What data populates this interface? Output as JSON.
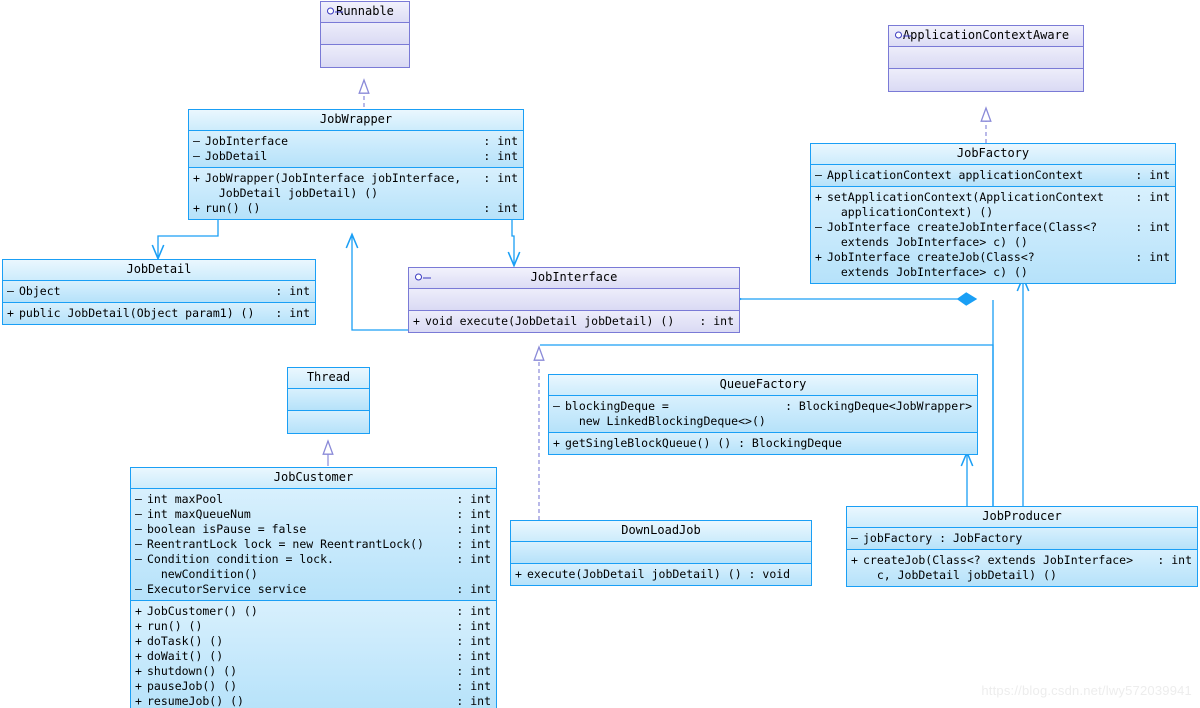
{
  "diagram": {
    "type": "uml-class-diagram",
    "watermark": "https://blog.csdn.net/lwy572039941"
  },
  "classes": {
    "runnable": {
      "name": "Runnable",
      "stereotype": "interface",
      "attributes": [],
      "operations": []
    },
    "applicationContextAware": {
      "name": "ApplicationContextAware",
      "stereotype": "interface",
      "attributes": [],
      "operations": []
    },
    "jobWrapper": {
      "name": "JobWrapper",
      "attributes": [
        {
          "vis": "–",
          "sig": "JobInterface",
          "type": ": int"
        },
        {
          "vis": "–",
          "sig": "JobDetail",
          "type": ": int"
        }
      ],
      "operations": [
        {
          "vis": "+",
          "sig": "JobWrapper(JobInterface jobInterface,\n  JobDetail jobDetail) ()",
          "type": ": int"
        },
        {
          "vis": "+",
          "sig": "run() ()",
          "type": ": int"
        }
      ]
    },
    "jobFactory": {
      "name": "JobFactory",
      "attributes": [
        {
          "vis": "–",
          "sig": "ApplicationContext applicationContext",
          "type": ": int"
        }
      ],
      "operations": [
        {
          "vis": "+",
          "sig": "setApplicationContext(ApplicationContext\n  applicationContext) ()",
          "type": ": int"
        },
        {
          "vis": "–",
          "sig": "JobInterface createJobInterface(Class<?\n  extends JobInterface> c) ()",
          "type": ": int"
        },
        {
          "vis": "+",
          "sig": "JobInterface createJob(Class<?\n  extends JobInterface> c) ()",
          "type": ": int"
        }
      ]
    },
    "jobDetail": {
      "name": "JobDetail",
      "attributes": [
        {
          "vis": "–",
          "sig": "Object",
          "type": ": int"
        }
      ],
      "operations": [
        {
          "vis": "+",
          "sig": "public JobDetail(Object param1) ()",
          "type": ": int"
        }
      ]
    },
    "jobInterface": {
      "name": "JobInterface",
      "stereotype": "interface",
      "attributes": [],
      "operations": [
        {
          "vis": "+",
          "sig": "void execute(JobDetail jobDetail) ()",
          "type": ": int"
        }
      ]
    },
    "thread": {
      "name": "Thread",
      "attributes": [],
      "operations": []
    },
    "jobCustomer": {
      "name": "JobCustomer",
      "attributes": [
        {
          "vis": "–",
          "sig": "int maxPool",
          "type": ": int"
        },
        {
          "vis": "–",
          "sig": "int maxQueueNum",
          "type": ": int"
        },
        {
          "vis": "–",
          "sig": "boolean isPause = false",
          "type": ": int"
        },
        {
          "vis": "–",
          "sig": "ReentrantLock lock = new ReentrantLock()",
          "type": ": int"
        },
        {
          "vis": "–",
          "sig": "Condition condition = lock.\n  newCondition()",
          "type": ": int"
        },
        {
          "vis": "–",
          "sig": "ExecutorService service",
          "type": ": int"
        }
      ],
      "operations": [
        {
          "vis": "+",
          "sig": "JobCustomer() ()",
          "type": ": int"
        },
        {
          "vis": "+",
          "sig": "run() ()",
          "type": ": int"
        },
        {
          "vis": "+",
          "sig": "doTask() ()",
          "type": ": int"
        },
        {
          "vis": "+",
          "sig": "doWait() ()",
          "type": ": int"
        },
        {
          "vis": "+",
          "sig": "shutdown() ()",
          "type": ": int"
        },
        {
          "vis": "+",
          "sig": "pauseJob() ()",
          "type": ": int"
        },
        {
          "vis": "+",
          "sig": "resumeJob() ()",
          "type": ": int"
        }
      ]
    },
    "queueFactory": {
      "name": "QueueFactory",
      "attributes": [
        {
          "vis": "–",
          "sig": "blockingDeque =\n  new LinkedBlockingDeque<>()",
          "type": ": BlockingDeque<JobWrapper>"
        }
      ],
      "operations": [
        {
          "vis": "+",
          "sig": "getSingleBlockQueue() () : BlockingDeque",
          "type": ""
        }
      ]
    },
    "downLoadJob": {
      "name": "DownLoadJob",
      "attributes": [],
      "operations": [
        {
          "vis": "+",
          "sig": "execute(JobDetail jobDetail) () : void",
          "type": ""
        }
      ]
    },
    "jobProducer": {
      "name": "JobProducer",
      "attributes": [
        {
          "vis": "–",
          "sig": "jobFactory : JobFactory",
          "type": ""
        }
      ],
      "operations": [
        {
          "vis": "+",
          "sig": "createJob(Class<? extends JobInterface>\n  c, JobDetail jobDetail) ()",
          "type": ": int"
        }
      ]
    }
  },
  "relationships": [
    {
      "name": "jobwrapper-realizes-runnable",
      "kind": "realization",
      "from": "JobWrapper",
      "to": "Runnable"
    },
    {
      "name": "jobfactory-realizes-applicationcontextaware",
      "kind": "realization",
      "from": "JobFactory",
      "to": "ApplicationContextAware"
    },
    {
      "name": "downloadjob-realizes-jobinterface",
      "kind": "realization",
      "from": "DownLoadJob",
      "to": "JobInterface"
    },
    {
      "name": "jobcustomer-extends-thread",
      "kind": "generalization",
      "from": "JobCustomer",
      "to": "Thread"
    },
    {
      "name": "jobwrapper-depends-jobdetail",
      "kind": "dependency",
      "from": "JobWrapper",
      "to": "JobDetail"
    },
    {
      "name": "jobwrapper-depends-jobinterface",
      "kind": "dependency",
      "from": "JobWrapper",
      "to": "JobInterface"
    },
    {
      "name": "jobinterface-association-jobwrapper",
      "kind": "association",
      "from": "JobInterface",
      "to": "JobWrapper"
    },
    {
      "name": "jobfactory-composes-jobinterface",
      "kind": "composition",
      "from": "JobFactory",
      "to": "JobInterface"
    },
    {
      "name": "jobproducer-composes-jobfactory",
      "kind": "composition",
      "from": "JobProducer",
      "to": "JobFactory"
    },
    {
      "name": "jobproducer-depends-jobfactory",
      "kind": "dependency",
      "from": "JobProducer",
      "to": "JobFactory"
    },
    {
      "name": "jobproducer-composes-queuefactory",
      "kind": "composition",
      "from": "JobProducer",
      "to": "QueueFactory"
    },
    {
      "name": "jobproducer-aggregates-jobinterface",
      "kind": "aggregation",
      "from": "JobProducer",
      "to": "JobInterface"
    }
  ]
}
